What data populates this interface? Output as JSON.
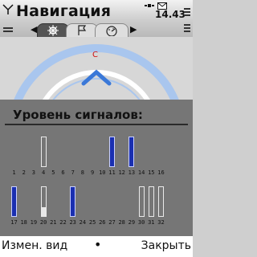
{
  "header": {
    "title": "Навигация",
    "clock": "14.43"
  },
  "tabs": [
    {
      "icon": "compass-icon",
      "active": true
    },
    {
      "icon": "flag-icon",
      "active": false
    },
    {
      "icon": "speedometer-icon",
      "active": false
    }
  ],
  "compass": {
    "heading_letter": "С"
  },
  "signal": {
    "title": "Уровень сигналов:",
    "satellites_row1": [
      {
        "num": "1",
        "level": 0,
        "state": "none"
      },
      {
        "num": "2",
        "level": 0,
        "state": "none"
      },
      {
        "num": "3",
        "level": 0,
        "state": "none"
      },
      {
        "num": "4",
        "level": 0.82,
        "state": "empty"
      },
      {
        "num": "5",
        "level": 0,
        "state": "none"
      },
      {
        "num": "6",
        "level": 0,
        "state": "none"
      },
      {
        "num": "7",
        "level": 0,
        "state": "none"
      },
      {
        "num": "8",
        "level": 0,
        "state": "none"
      },
      {
        "num": "9",
        "level": 0,
        "state": "none"
      },
      {
        "num": "10",
        "level": 0,
        "state": "none"
      },
      {
        "num": "11",
        "level": 0.82,
        "state": "used"
      },
      {
        "num": "12",
        "level": 0,
        "state": "none"
      },
      {
        "num": "13",
        "level": 0.82,
        "state": "used"
      },
      {
        "num": "14",
        "level": 0,
        "state": "none"
      },
      {
        "num": "15",
        "level": 0,
        "state": "none"
      },
      {
        "num": "16",
        "level": 0,
        "state": "none"
      }
    ],
    "satellites_row2": [
      {
        "num": "17",
        "level": 0.82,
        "state": "used"
      },
      {
        "num": "18",
        "level": 0,
        "state": "none"
      },
      {
        "num": "19",
        "level": 0,
        "state": "none"
      },
      {
        "num": "20",
        "level": 0.82,
        "state": "partial",
        "fill": 0.3
      },
      {
        "num": "21",
        "level": 0,
        "state": "none"
      },
      {
        "num": "22",
        "level": 0,
        "state": "none"
      },
      {
        "num": "23",
        "level": 0.82,
        "state": "used"
      },
      {
        "num": "24",
        "level": 0,
        "state": "none"
      },
      {
        "num": "25",
        "level": 0,
        "state": "none"
      },
      {
        "num": "26",
        "level": 0,
        "state": "none"
      },
      {
        "num": "27",
        "level": 0,
        "state": "none"
      },
      {
        "num": "28",
        "level": 0,
        "state": "none"
      },
      {
        "num": "29",
        "level": 0,
        "state": "none"
      },
      {
        "num": "30",
        "level": 0.82,
        "state": "empty"
      },
      {
        "num": "31",
        "level": 0.82,
        "state": "empty"
      },
      {
        "num": "32",
        "level": 0.82,
        "state": "empty"
      }
    ]
  },
  "softkeys": {
    "left": "Измен. вид",
    "middle": "•",
    "right": "Закрыть"
  },
  "colors": {
    "used_bar": "#1a2fb0",
    "partial_bar": "#e8e8e8",
    "compass_ring": "#a9c6ee",
    "heading_letter": "#d01010"
  }
}
